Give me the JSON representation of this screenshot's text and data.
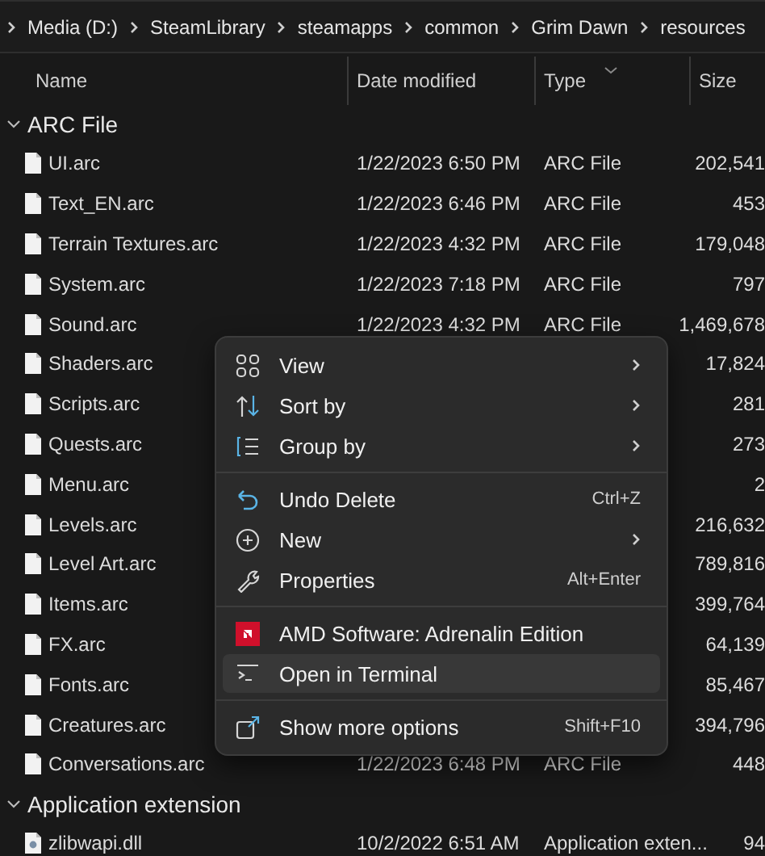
{
  "breadcrumb": [
    "Media (D:)",
    "SteamLibrary",
    "steamapps",
    "common",
    "Grim Dawn",
    "resources"
  ],
  "columns": [
    {
      "label": "Name"
    },
    {
      "label": "Date modified"
    },
    {
      "label": "Type",
      "sorted": true
    },
    {
      "label": "Size"
    }
  ],
  "groups": [
    {
      "label": "ARC File",
      "expanded": true,
      "rows": [
        {
          "kind": "document",
          "name": "UI.arc",
          "date": "1/22/2023 6:50 PM",
          "type": "ARC File",
          "size": "202,541"
        },
        {
          "kind": "document",
          "name": "Text_EN.arc",
          "date": "1/22/2023 6:46 PM",
          "type": "ARC File",
          "size": "453"
        },
        {
          "kind": "document",
          "name": "Terrain Textures.arc",
          "date": "1/22/2023 4:32 PM",
          "type": "ARC File",
          "size": "179,048"
        },
        {
          "kind": "document",
          "name": "System.arc",
          "date": "1/22/2023 7:18 PM",
          "type": "ARC File",
          "size": "797"
        },
        {
          "kind": "document",
          "name": "Sound.arc",
          "date": "1/22/2023 4:32 PM",
          "type": "ARC File",
          "size": "1,469,678"
        },
        {
          "kind": "document",
          "name": "Shaders.arc",
          "size": "17,824"
        },
        {
          "kind": "document",
          "name": "Scripts.arc",
          "size": "281"
        },
        {
          "kind": "document",
          "name": "Quests.arc",
          "size": "273"
        },
        {
          "kind": "document",
          "name": "Menu.arc",
          "size": "2"
        },
        {
          "kind": "document",
          "name": "Levels.arc",
          "size": "216,632"
        },
        {
          "kind": "document",
          "name": "Level Art.arc",
          "size": "789,816"
        },
        {
          "kind": "document",
          "name": "Items.arc",
          "size": "399,764"
        },
        {
          "kind": "document",
          "name": "FX.arc",
          "size": "64,139"
        },
        {
          "kind": "document",
          "name": "Fonts.arc",
          "size": "85,467"
        },
        {
          "kind": "document",
          "name": "Creatures.arc",
          "size": "394,796"
        },
        {
          "kind": "document",
          "name": "Conversations.arc",
          "date": "1/22/2023 6:48 PM",
          "type": "ARC File",
          "size": "448"
        }
      ]
    },
    {
      "label": "Application extension",
      "expanded": true,
      "rows": [
        {
          "kind": "library",
          "name": "zlibwapi.dll",
          "date": "10/2/2022 6:51 AM",
          "type": "Application exten...",
          "size": "94"
        }
      ]
    }
  ],
  "context_menu": {
    "sections": [
      [
        {
          "kind": "view",
          "label": "View",
          "submenu": true,
          "selected": false
        },
        {
          "kind": "sort",
          "label": "Sort by",
          "submenu": true,
          "selected": false
        },
        {
          "kind": "group",
          "label": "Group by",
          "submenu": true,
          "selected": false
        }
      ],
      [
        {
          "kind": "undo",
          "label": "Undo Delete",
          "shortcut": "Ctrl+Z",
          "submenu": false,
          "selected": false
        },
        {
          "kind": "new",
          "label": "New",
          "submenu": true,
          "selected": false
        },
        {
          "kind": "properties",
          "label": "Properties",
          "shortcut": "Alt+Enter",
          "submenu": false,
          "selected": false
        }
      ],
      [
        {
          "kind": "amd",
          "label": "AMD Software: Adrenalin Edition",
          "submenu": false,
          "selected": false
        },
        {
          "kind": "terminal",
          "label": "Open in Terminal",
          "submenu": false,
          "selected": true
        }
      ],
      [
        {
          "kind": "more",
          "label": "Show more options",
          "shortcut": "Shift+F10",
          "submenu": false,
          "selected": false
        }
      ]
    ]
  }
}
